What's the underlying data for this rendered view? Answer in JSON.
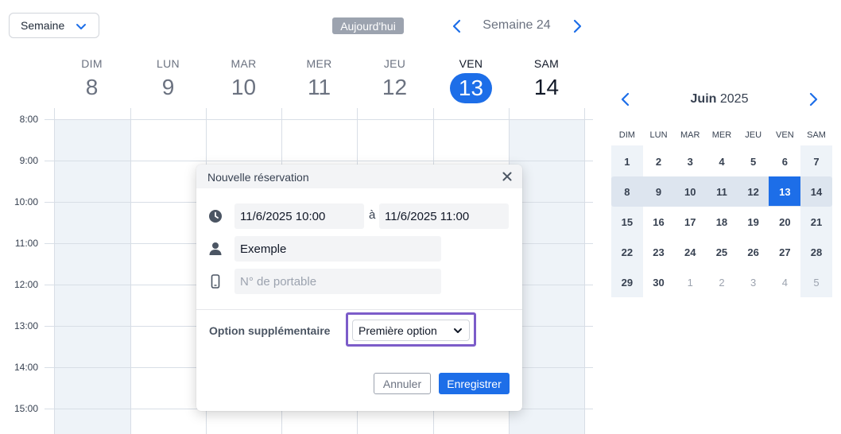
{
  "toolbar": {
    "view_select": "Semaine",
    "today_label": "Aujourd'hui",
    "week_label": "Semaine 24"
  },
  "days": [
    {
      "name": "DIM",
      "num": "8"
    },
    {
      "name": "LUN",
      "num": "9"
    },
    {
      "name": "MAR",
      "num": "10"
    },
    {
      "name": "MER",
      "num": "11"
    },
    {
      "name": "JEU",
      "num": "12"
    },
    {
      "name": "VEN",
      "num": "13"
    },
    {
      "name": "SAM",
      "num": "14"
    }
  ],
  "times": [
    "8:00",
    "9:00",
    "10:00",
    "11:00",
    "12:00",
    "13:00",
    "14:00",
    "15:00"
  ],
  "dialog": {
    "title": "Nouvelle réservation",
    "start": "11/6/2025  10:00",
    "separator": "à",
    "end": "11/6/2025  11:00",
    "name_value": "Exemple",
    "phone_placeholder": "N° de portable",
    "option_label": "Option supplémentaire",
    "option_value": "Première option",
    "cancel_label": "Annuler",
    "save_label": "Enregistrer"
  },
  "mini_calendar": {
    "month": "Juin",
    "year": "2025",
    "day_names": [
      "DIM",
      "LUN",
      "MAR",
      "MER",
      "JEU",
      "VEN",
      "SAM"
    ],
    "weeks": [
      [
        "1",
        "2",
        "3",
        "4",
        "5",
        "6",
        "7"
      ],
      [
        "8",
        "9",
        "10",
        "11",
        "12",
        "13",
        "14"
      ],
      [
        "15",
        "16",
        "17",
        "18",
        "19",
        "20",
        "21"
      ],
      [
        "22",
        "23",
        "24",
        "25",
        "26",
        "27",
        "28"
      ],
      [
        "29",
        "30",
        "1",
        "2",
        "3",
        "4",
        "5"
      ]
    ],
    "selected": "13"
  },
  "colors": {
    "accent": "#1d6ee8",
    "focus_ring": "#7c5cc9",
    "weekend_shade": "#eef3f8"
  }
}
